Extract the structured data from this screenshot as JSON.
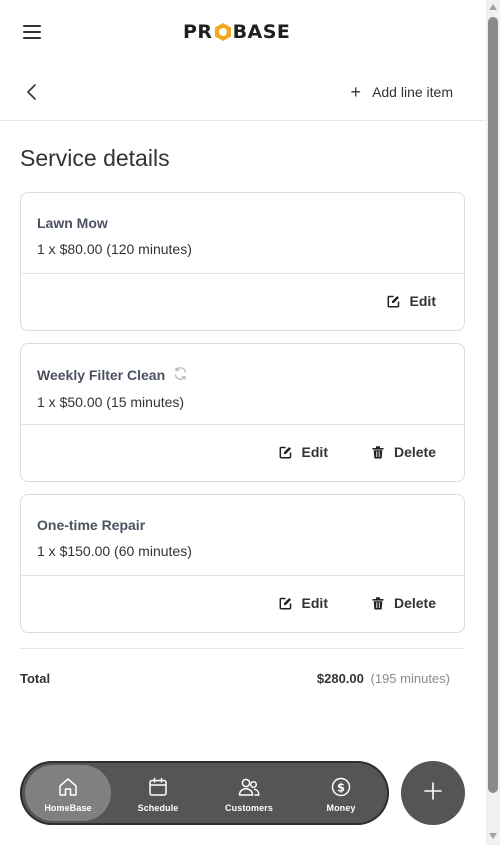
{
  "header": {
    "logo_left": "PR",
    "logo_right": "BASE",
    "add_line_item_label": "Add line item"
  },
  "page": {
    "title": "Service details"
  },
  "items": [
    {
      "name": "Lawn Mow",
      "detail": "1 x $80.00 (120 minutes)",
      "recurring": false,
      "edit_label": "Edit",
      "delete_label": ""
    },
    {
      "name": "Weekly Filter Clean",
      "detail": "1 x $50.00 (15 minutes)",
      "recurring": true,
      "edit_label": "Edit",
      "delete_label": "Delete"
    },
    {
      "name": "One-time Repair",
      "detail": "1 x $150.00 (60 minutes)",
      "recurring": false,
      "edit_label": "Edit",
      "delete_label": "Delete"
    }
  ],
  "total": {
    "label": "Total",
    "amount": "$280.00",
    "minutes": "(195 minutes)"
  },
  "nav": {
    "items": [
      {
        "label": "HomeBase",
        "icon": "home-icon",
        "active": true
      },
      {
        "label": "Schedule",
        "icon": "calendar-icon",
        "active": false
      },
      {
        "label": "Customers",
        "icon": "users-icon",
        "active": false
      },
      {
        "label": "Money",
        "icon": "dollar-icon",
        "active": false
      }
    ]
  },
  "colors": {
    "nav_bg": "#555557",
    "nav_active": "#808082",
    "logo_accent": "#f2a81d",
    "item_name": "#4a5260"
  }
}
